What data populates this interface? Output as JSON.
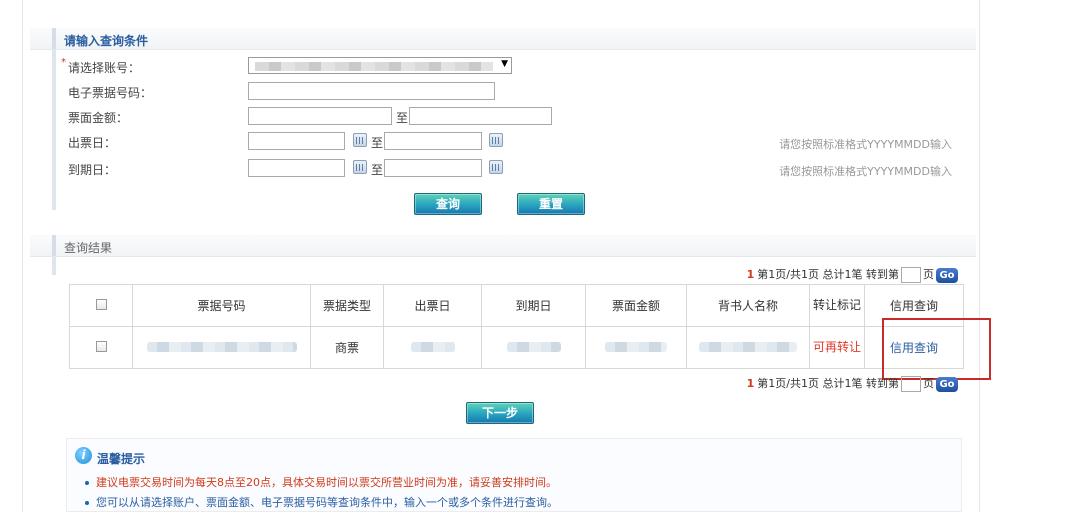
{
  "query_section": {
    "title": "请输入查询条件",
    "required_mark": "*",
    "account_label": "请选择账号：",
    "bill_no_label": "电子票据号码：",
    "amount_label": "票面金额：",
    "issue_date_label": "出票日：",
    "due_date_label": "到期日：",
    "to_label": "至",
    "date_format_hint": "请您按照标准格式YYYYMMDD输入",
    "query_button": "查询",
    "reset_button": "重置"
  },
  "result_section": {
    "title": "查询结果",
    "pager": {
      "current_page": "1",
      "summary": "第1页/共1页 总计1笔 转到第",
      "page_unit": "页",
      "go_label": "Go"
    },
    "columns": [
      "票据号码",
      "票据类型",
      "出票日",
      "到期日",
      "票面金额",
      "背书人名称",
      "转让标记",
      "信用查询"
    ],
    "rows": [
      {
        "bill_type": "商票",
        "transfer_flag": "可再转让",
        "credit_query_link": "信用查询"
      }
    ],
    "next_button": "下一步"
  },
  "tips": {
    "icon": "info-icon",
    "title": "温馨提示",
    "lines": [
      "建议电票交易时间为每天8点至20点，具体交易时间以票交所营业时间为准，请妥善安排时间。",
      "您可以从请选择账户、票面金额、电子票据号码等查询条件中，输入一个或多个条件进行查询。"
    ]
  },
  "colors": {
    "accent_blue": "#2a5ea0",
    "highlight_red": "#c92a2a",
    "transfer_red": "#e03a2a"
  }
}
